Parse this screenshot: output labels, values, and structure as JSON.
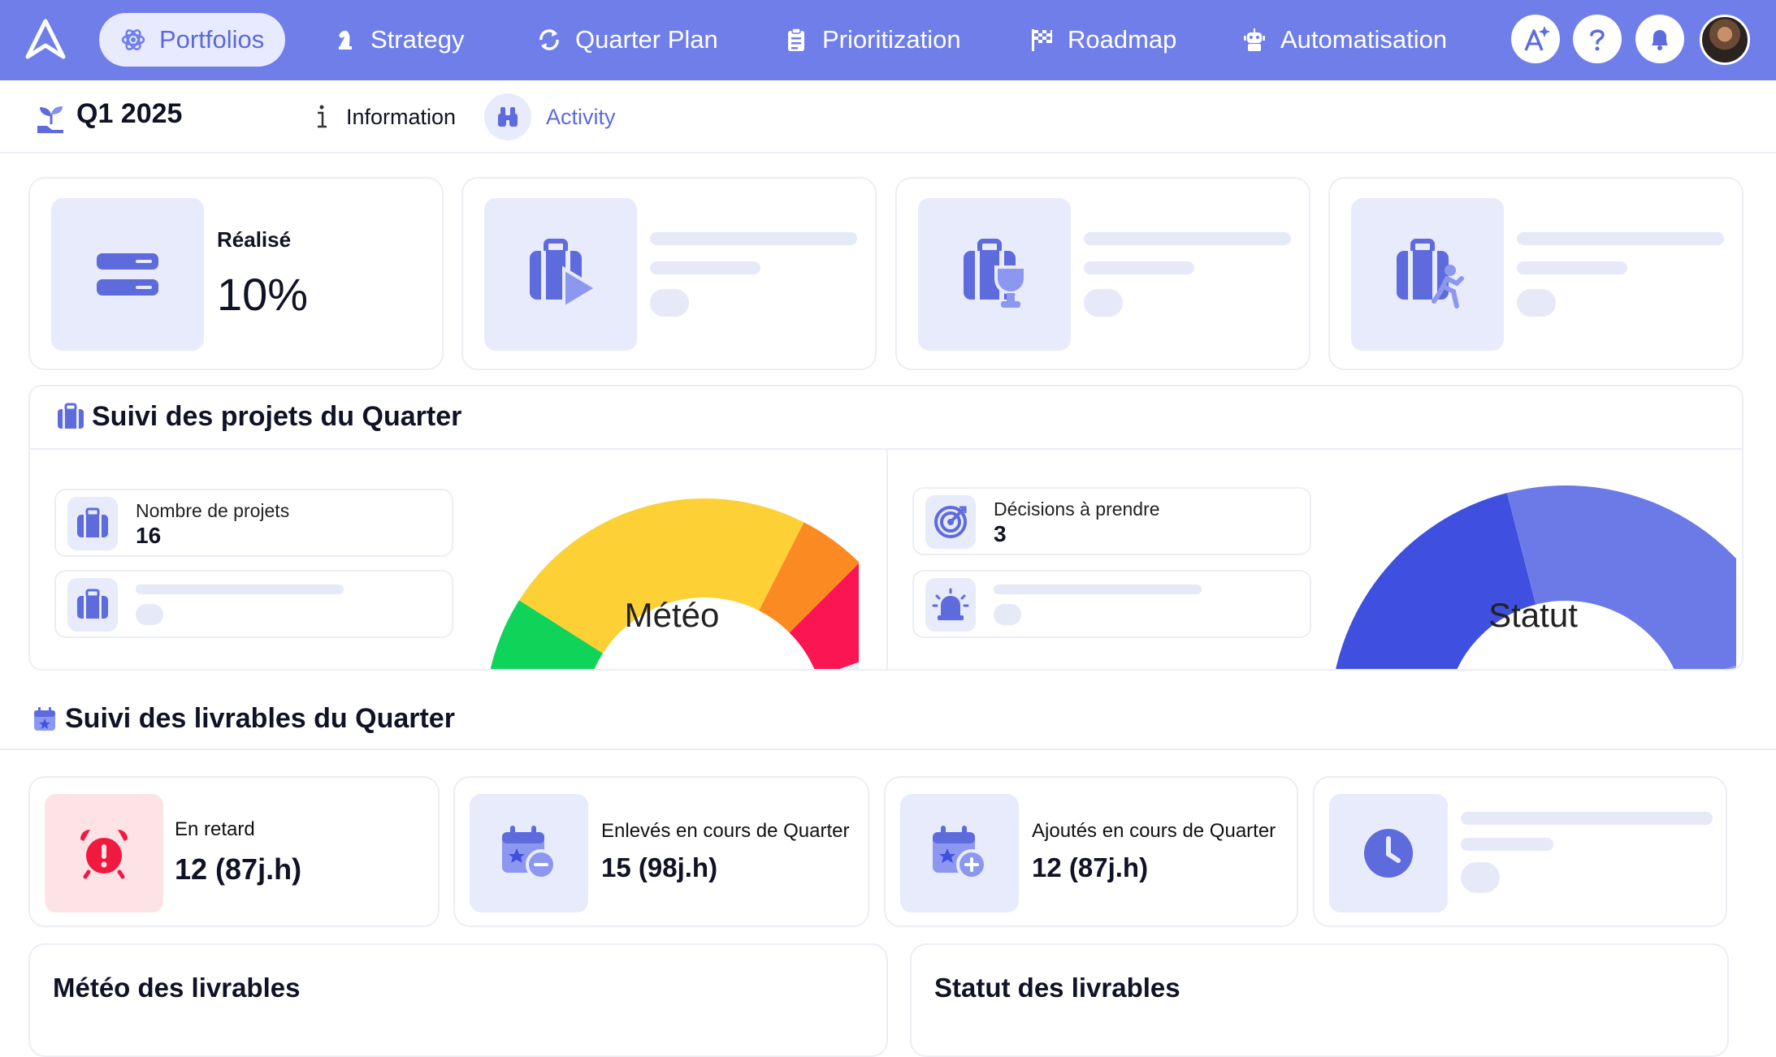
{
  "app": {
    "logo_icon": "brand-a-logo-icon"
  },
  "nav": {
    "items": [
      {
        "label": "Portfolios",
        "icon": "molecule-icon",
        "active": true
      },
      {
        "label": "Strategy",
        "icon": "chess-knight-icon"
      },
      {
        "label": "Quarter Plan",
        "icon": "refresh-cycle-icon"
      },
      {
        "label": "Prioritization",
        "icon": "clipboard-list-icon"
      },
      {
        "label": "Roadmap",
        "icon": "checkered-flag-icon"
      },
      {
        "label": "Automatisation",
        "icon": "robot-icon"
      }
    ],
    "actions": [
      "ai-sparkle-icon",
      "help-icon",
      "bell-icon",
      "avatar"
    ]
  },
  "subheader": {
    "title": "Q1 2025",
    "title_icon": "sprout-icon",
    "tabs": [
      {
        "label": "Information",
        "icon": "info-icon"
      },
      {
        "label": "Activity",
        "icon": "binoculars-icon",
        "active": true
      }
    ]
  },
  "kpis": [
    {
      "label": "Réalisé",
      "value": "10%",
      "icon": "progress-bars-icon"
    },
    {
      "label": "",
      "value": "",
      "icon": "briefcase-play-icon",
      "loading": true
    },
    {
      "label": "",
      "value": "",
      "icon": "briefcase-trophy-icon",
      "loading": true
    },
    {
      "label": "",
      "value": "",
      "icon": "briefcase-running-icon",
      "loading": true
    }
  ],
  "projects_section": {
    "title": "Suivi des projets du Quarter",
    "count_label": "Nombre de projets",
    "count_value": "16",
    "decisions_label": "Décisions à prendre",
    "decisions_value": "3",
    "weather_gauge": {
      "label": "Météo",
      "segments": [
        {
          "color": "#10d45a",
          "fraction": 0.18
        },
        {
          "color": "#fdd035",
          "fraction": 0.47
        },
        {
          "color": "#fb8a23",
          "fraction": 0.1
        },
        {
          "color": "#fb1552",
          "fraction": 0.14
        },
        {
          "color": "#eef0f7",
          "fraction": 0.11
        }
      ]
    },
    "status_gauge": {
      "label": "Statut",
      "segments": [
        {
          "color": "#3f4fe0",
          "fraction": 0.42
        },
        {
          "color": "#6b7ae6",
          "fraction": 0.48
        },
        {
          "color": "#8f9bef",
          "fraction": 0.1
        }
      ]
    }
  },
  "deliverables_section": {
    "title": "Suivi des livrables du Quarter",
    "cards": [
      {
        "label": "En retard",
        "value": "12 (87j.h)",
        "icon": "alarm-clock-icon"
      },
      {
        "label": "Enlevés en cours de Quarter",
        "value": "15 (98j.h)",
        "icon": "calendar-minus-icon"
      },
      {
        "label": "Ajoutés en cours de Quarter",
        "value": "12 (87j.h)",
        "icon": "calendar-plus-icon"
      },
      {
        "label": "",
        "value": "",
        "icon": "clock-icon",
        "loading": true
      }
    ],
    "weather_title": "Météo des livrables",
    "status_title": "Statut des livrables"
  },
  "colors": {
    "primary": "#6f7ee9",
    "tile_bg": "#e8ebfb",
    "danger_bg": "#fde2e6",
    "danger": "#f0193f",
    "icon": "#5e6bdc"
  }
}
